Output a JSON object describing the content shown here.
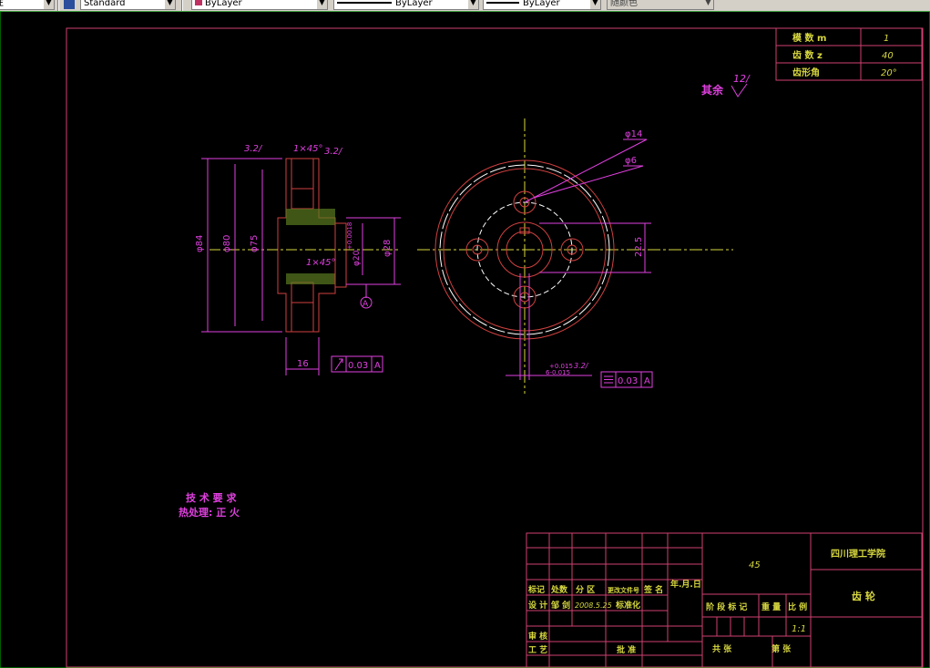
{
  "toolbar": {
    "layer_combo": "线性",
    "text_style_combo": "Standard",
    "color_combo": "ByLayer",
    "linetype_combo": "ByLayer",
    "lineweight_combo": "ByLayer",
    "plotstyle_combo": "随颜色"
  },
  "params_table": [
    {
      "label": "模 数 m",
      "value": "1"
    },
    {
      "label": "齿 数 z",
      "value": "40"
    },
    {
      "label": "齿形角",
      "value": "20°"
    }
  ],
  "roughness_note": {
    "text": "其余",
    "value": "12/"
  },
  "left_view": {
    "dims": {
      "d84": "φ84",
      "d80": "φ80",
      "d75": "φ75",
      "d20": "φ20",
      "tol_top": "+0.0018",
      "d28": "φ28",
      "width": "16",
      "chamfer_top": "1×45°",
      "chamfer_mid": "1×45°",
      "rough_a": "3.2/",
      "rough_b": "3.2/"
    },
    "datum": "A",
    "gdt_value": "0.03",
    "gdt_datum": "A"
  },
  "right_view": {
    "dims": {
      "d14": "φ14",
      "d6": "φ6",
      "pcd": "22.5",
      "keyway": "6-0.015",
      "keyway_top": "+0.015",
      "rough": "3.2/"
    },
    "gdt_value": "0.03",
    "gdt_datum": "A"
  },
  "tech_req": {
    "title": "技 术 要 求",
    "line1": "热处理: 正 火"
  },
  "title_block": {
    "material": "45",
    "school": "四川理工学院",
    "part_name": "齿 轮",
    "row_headers": [
      "标记",
      "处数",
      "分 区",
      "更改文件号",
      "签 名",
      "年.月.日"
    ],
    "design_row": [
      "设 计",
      "邹 剑",
      "2008.5.25",
      "标准化"
    ],
    "review": "审 核",
    "process": "工 艺",
    "approve": "批 准",
    "stage_headers": [
      "阶 段 标 记",
      "重 量",
      "比 例"
    ],
    "scale": "1:1",
    "total_sheets": "共   张",
    "sheet_no": "第   张"
  }
}
